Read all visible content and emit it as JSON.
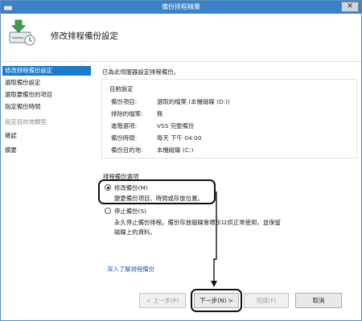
{
  "window": {
    "title": "備份排程精靈",
    "close_glyph": "✕"
  },
  "header": {
    "title": "修改排程備份設定",
    "icon": "backup-wizard-icon"
  },
  "sidebar": {
    "items": [
      {
        "label": "修改排程備份設定",
        "state": "active"
      },
      {
        "label": "選取備份設定",
        "state": "normal"
      },
      {
        "label": "選取要備份的項目",
        "state": "normal"
      },
      {
        "label": "指定備份時間",
        "state": "normal"
      },
      {
        "label": "指定目的地類型",
        "state": "disabled"
      },
      {
        "label": "確認",
        "state": "normal"
      },
      {
        "label": "摘要",
        "state": "normal"
      }
    ]
  },
  "content": {
    "intro": "已為此伺服器設定排程備份。",
    "current_settings": {
      "title": "目前設定",
      "rows": [
        {
          "label": "備份項目:",
          "value": "選取的檔案 (本機磁碟 (D:))"
        },
        {
          "label": "排除的檔案:",
          "value": "無"
        },
        {
          "label": "進階選項:",
          "value": "VSS 完整備份"
        },
        {
          "label": "備份時間:",
          "value": "每天 下午 04:00"
        },
        {
          "label": "備份目的地:",
          "value": "本機磁碟 (C:)"
        }
      ]
    },
    "options": {
      "title": "排程備份選項",
      "modify": {
        "label": "修改備份(M)",
        "description": "變更備份項目、時間或存放位置。",
        "checked": true
      },
      "stop": {
        "label": "停止備份(S)",
        "description_line1": "永久停止備份排程。備份存放磁碟會標示以供正常使用，並保留",
        "description_line2": "磁碟上的資料。",
        "checked": false
      }
    },
    "add_link": "深入了解排程備份"
  },
  "buttons": {
    "prev": "< 上一步(P)",
    "next": "下一步(N) >",
    "finish": "完成(F)",
    "cancel": "取消"
  },
  "colors": {
    "titlebar": "#3a81c8",
    "active_nav": "#1b7ac9",
    "link": "#1f5fb0",
    "annotation": "#111111"
  }
}
